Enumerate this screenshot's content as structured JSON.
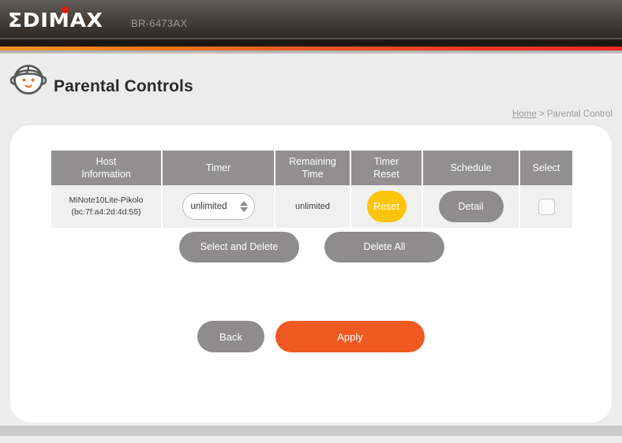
{
  "header": {
    "brand": "ΣDIMAX",
    "model": "BR-6473AX"
  },
  "page": {
    "title": "Parental Controls",
    "icon": "child-face-icon",
    "breadcrumb": {
      "home": "Home",
      "separator": ">",
      "current": "Parental Control"
    }
  },
  "table": {
    "columns": [
      "Host Information",
      "Timer",
      "Remaining Time",
      "Timer Reset",
      "Schedule",
      "Select"
    ],
    "columns_lines": [
      [
        "Host",
        "Information"
      ],
      [
        "Timer"
      ],
      [
        "Remaining",
        "Time"
      ],
      [
        "Timer",
        "Reset"
      ],
      [
        "Schedule"
      ],
      [
        "Select"
      ]
    ],
    "rows": [
      {
        "host_name": "MiNote10Lite-Pikolo",
        "host_mac": "(bc:7f:a4:2d:4d:55)",
        "timer_value": "unlimited",
        "remaining_time": "unlimited",
        "timer_reset_label": "Reset",
        "schedule_label": "Detail",
        "selected": false
      }
    ]
  },
  "actions": {
    "select_and_delete": "Select and Delete",
    "delete_all": "Delete All",
    "back": "Back",
    "apply": "Apply"
  },
  "colors": {
    "accent_orange": "#f05a22",
    "accent_red": "#ef2a24",
    "reset_yellow": "#fcc40b",
    "gray_button": "#8e8c8c",
    "table_header_gray": "#918f8f",
    "row_gray": "#f0f0f0",
    "page_bg": "#ececec",
    "brand_dot_red": "#e01b12"
  }
}
